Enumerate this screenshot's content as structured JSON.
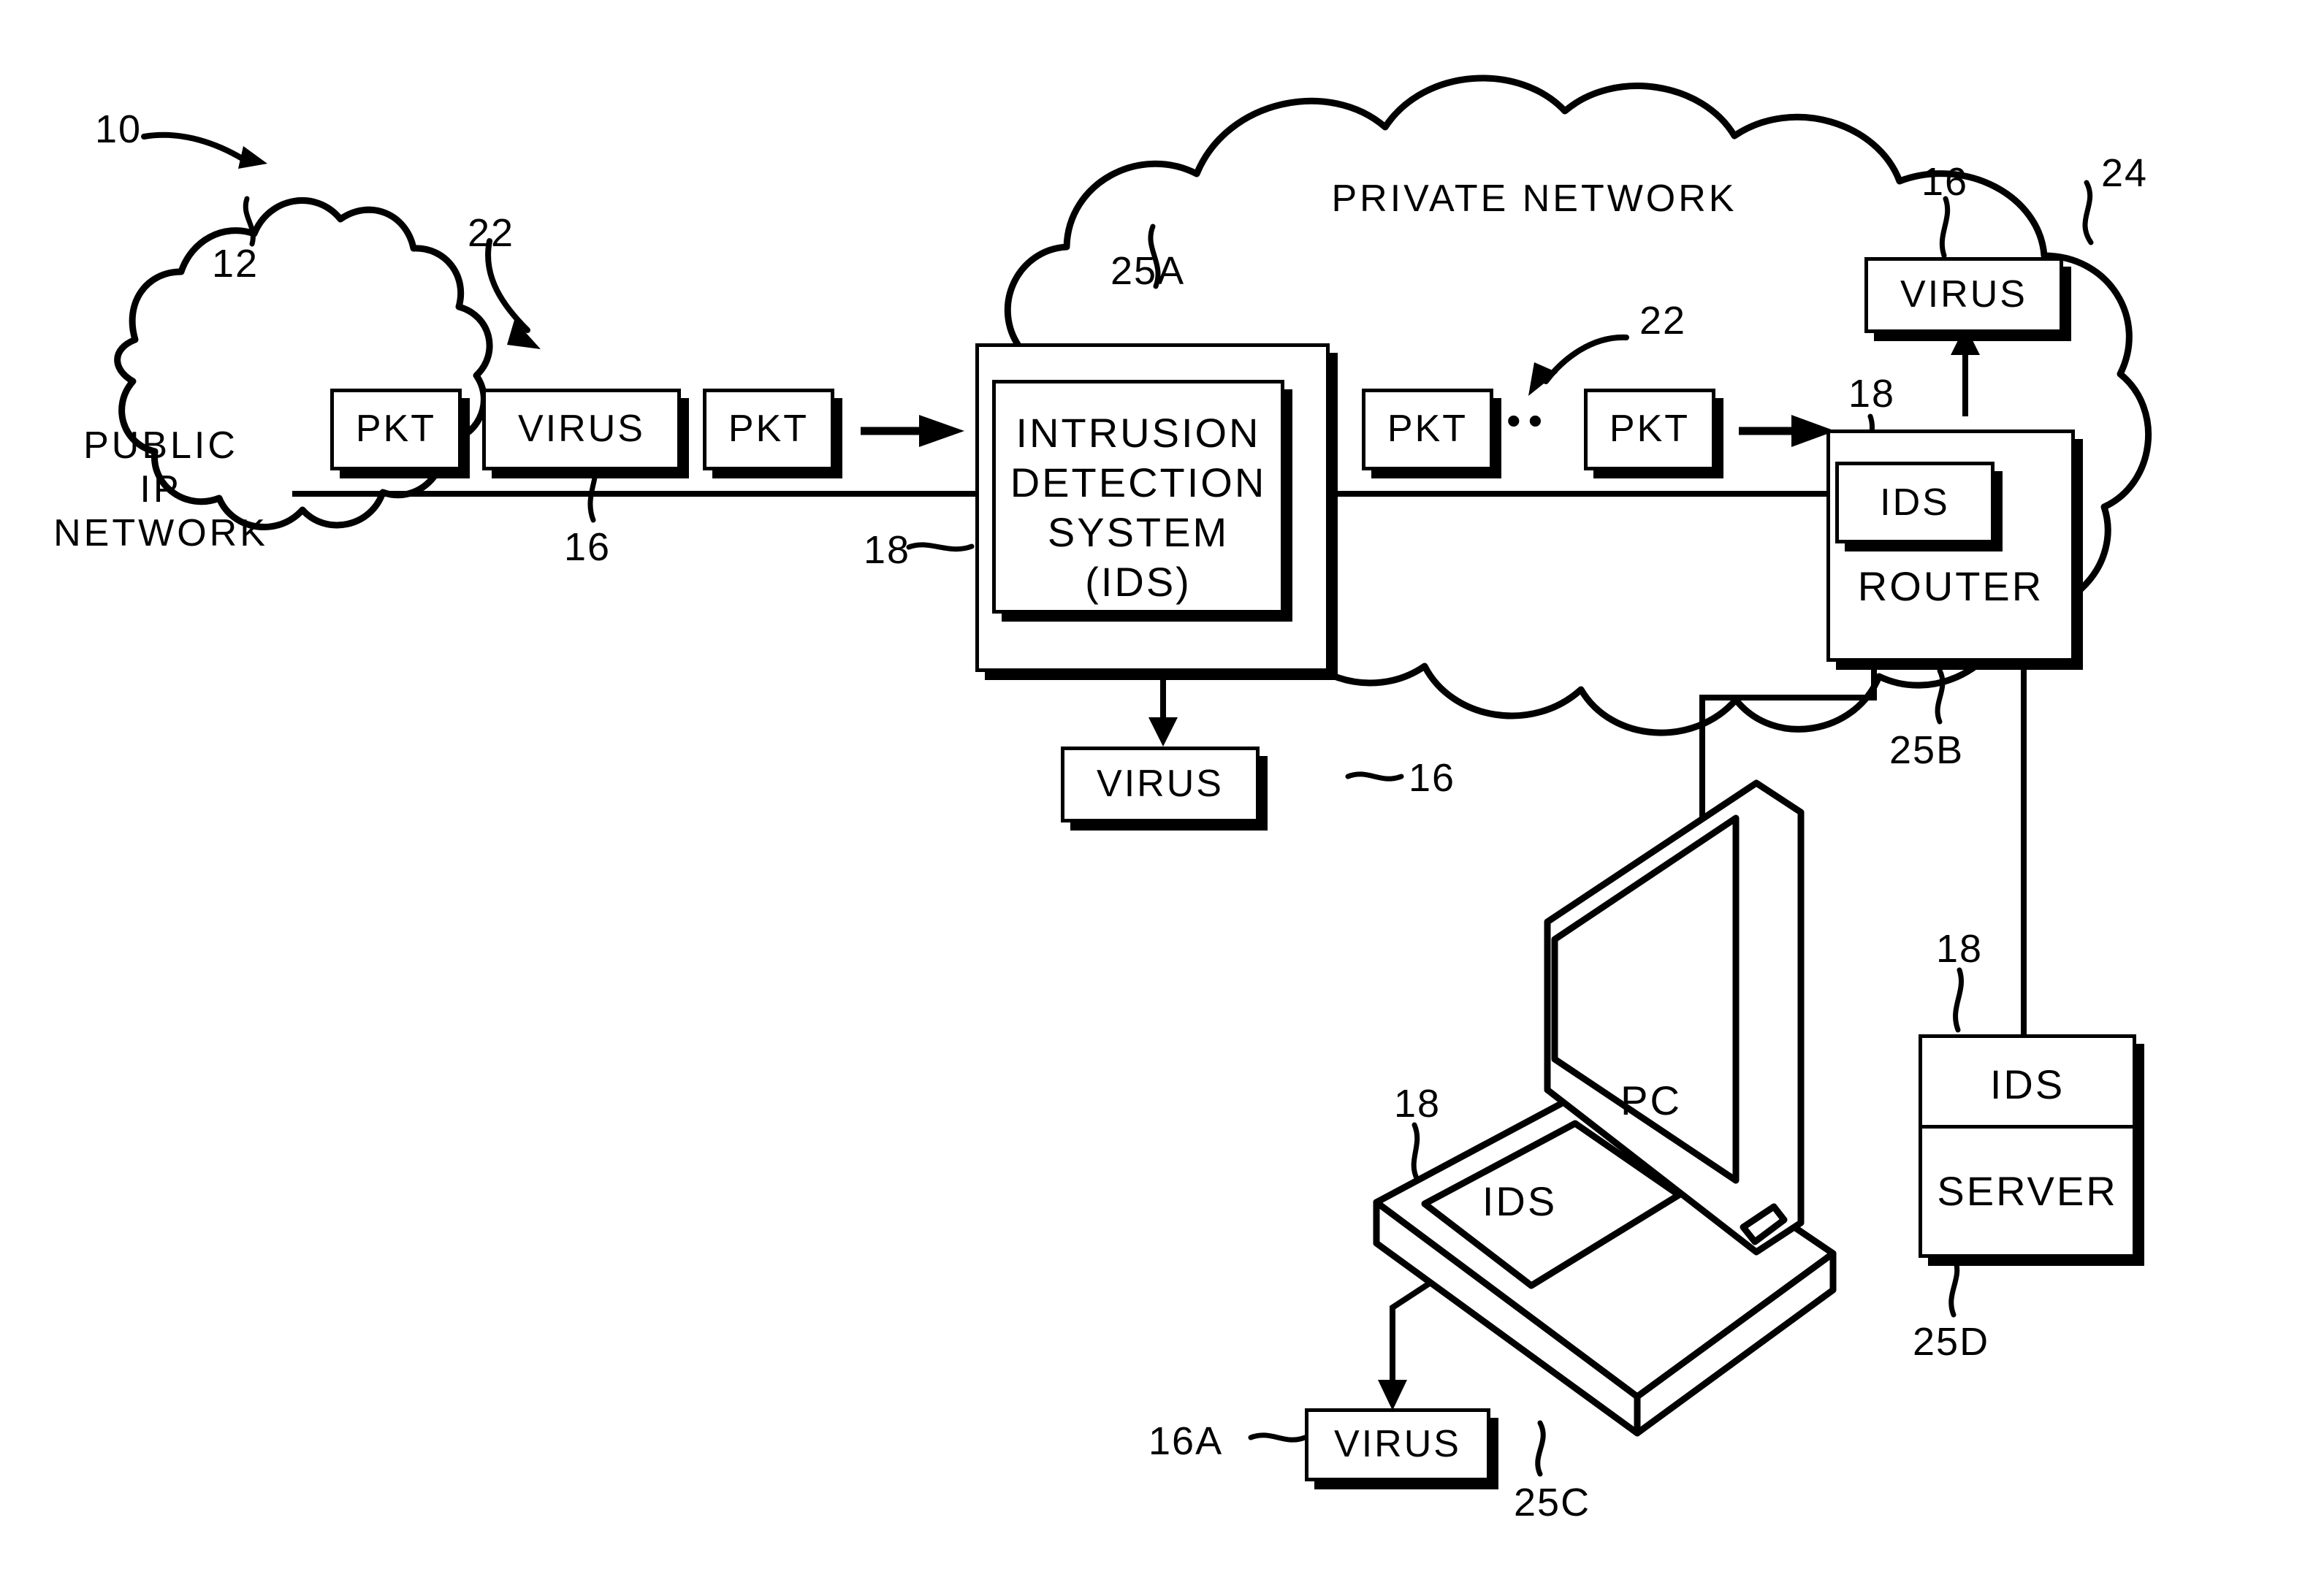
{
  "figure": {
    "ref_system": "10",
    "public_cloud": {
      "label_lines": [
        "PUBLIC",
        "IP",
        "NETWORK"
      ],
      "ref": "12"
    },
    "private_cloud": {
      "label": "PRIVATE NETWORK",
      "ref": "24"
    },
    "inbound_stream": {
      "ref": "22",
      "packets": [
        {
          "label": "PKT"
        },
        {
          "label": "VIRUS",
          "ref": "16"
        },
        {
          "label": "PKT"
        }
      ]
    },
    "outbound_stream": {
      "ref": "22",
      "packets": [
        {
          "label": "PKT"
        },
        {
          "label": "PKT"
        }
      ],
      "ellipsis": "••"
    },
    "ids_appliance": {
      "label_lines": [
        "INTRUSION",
        "DETECTION",
        "SYSTEM",
        "(IDS)"
      ],
      "ref_node": "25A",
      "ref_ids": "18"
    },
    "ids_dropped_virus": {
      "label": "VIRUS",
      "ref": "16"
    },
    "router": {
      "label": "ROUTER",
      "ids_label": "IDS",
      "ref_node": "25B",
      "ref_ids": "18"
    },
    "router_dropped_virus": {
      "label": "VIRUS",
      "ref": "16"
    },
    "pc": {
      "screen_label": "PC",
      "ids_label": "IDS",
      "ref_node": "25C",
      "ref_ids": "18"
    },
    "pc_dropped_virus": {
      "label": "VIRUS",
      "ref": "16A"
    },
    "server": {
      "ids_label": "IDS",
      "label": "SERVER",
      "ref_node": "25D",
      "ref_ids": "18"
    }
  },
  "colors": {
    "ink": "#000000",
    "paper": "#ffffff"
  }
}
